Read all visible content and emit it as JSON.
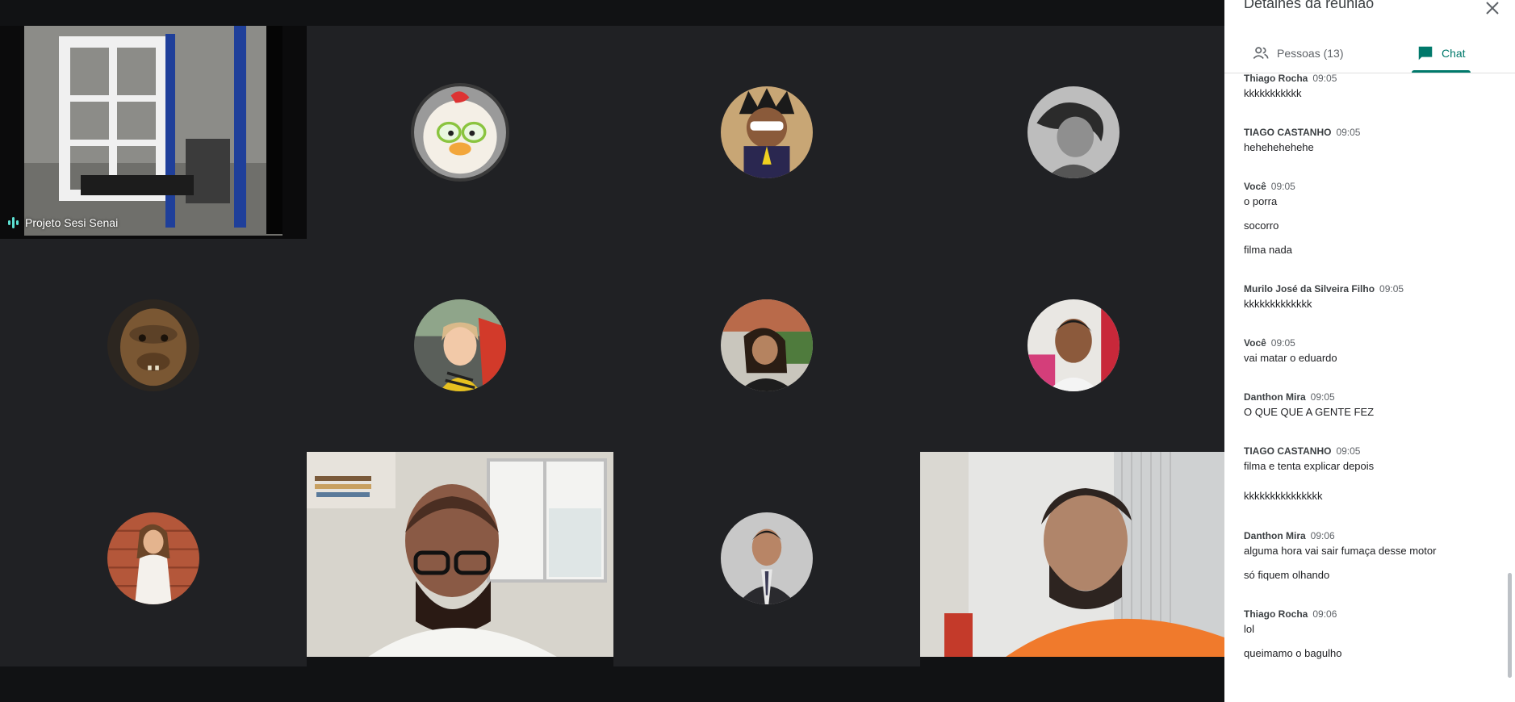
{
  "meeting": {
    "self_tile_label": "Projeto Sesi Senai"
  },
  "participants": [
    {
      "tile": "self",
      "icon": "camera-feed"
    },
    {
      "tile": "avatar",
      "icon": "chicken-cartoon-avatar"
    },
    {
      "tile": "avatar",
      "icon": "masked-hero-avatar"
    },
    {
      "tile": "avatar",
      "icon": "grayscale-face-avatar"
    },
    {
      "tile": "avatar",
      "icon": "ape-avatar"
    },
    {
      "tile": "avatar",
      "icon": "child-avatar"
    },
    {
      "tile": "avatar",
      "icon": "woman-avatar"
    },
    {
      "tile": "avatar",
      "icon": "man-avatar"
    },
    {
      "tile": "avatar",
      "icon": "woman-brick-wall-avatar"
    },
    {
      "tile": "video",
      "icon": "bald-man-video"
    },
    {
      "tile": "avatar",
      "icon": "man-suit-avatar"
    },
    {
      "tile": "video",
      "icon": "orange-shirt-man-video"
    }
  ],
  "panel": {
    "title": "Detalhes da reunião",
    "tabs": {
      "people": "Pessoas (13)",
      "chat": "Chat"
    },
    "accent_color": "#00796b"
  },
  "chat": {
    "messages": [
      {
        "sender": "Thiago Rocha",
        "time": "09:05",
        "lines": [
          "kkkkkkkkkkk"
        ]
      },
      {
        "sender": "TIAGO CASTANHO",
        "time": "09:05",
        "lines": [
          "hehehehehehe"
        ]
      },
      {
        "sender": "Você",
        "time": "09:05",
        "lines": [
          "o porra",
          "socorro",
          "filma nada"
        ]
      },
      {
        "sender": "Murilo José da Silveira Filho",
        "time": "09:05",
        "lines": [
          "kkkkkkkkkkkkk"
        ]
      },
      {
        "sender": "Você",
        "time": "09:05",
        "lines": [
          "vai matar o eduardo"
        ]
      },
      {
        "sender": "Danthon Mira",
        "time": "09:05",
        "lines": [
          "O QUE QUE A GENTE FEZ"
        ]
      },
      {
        "sender": "TIAGO CASTANHO",
        "time": "09:05",
        "lines": [
          "filma e tenta explicar depois",
          "kkkkkkkkkkkkkkk"
        ]
      },
      {
        "sender": "Danthon Mira",
        "time": "09:06",
        "lines": [
          "alguma hora vai sair fumaça desse motor",
          "só fiquem olhando"
        ]
      },
      {
        "sender": "Thiago Rocha",
        "time": "09:06",
        "lines": [
          "lol",
          "queimamo o bagulho"
        ]
      }
    ]
  }
}
